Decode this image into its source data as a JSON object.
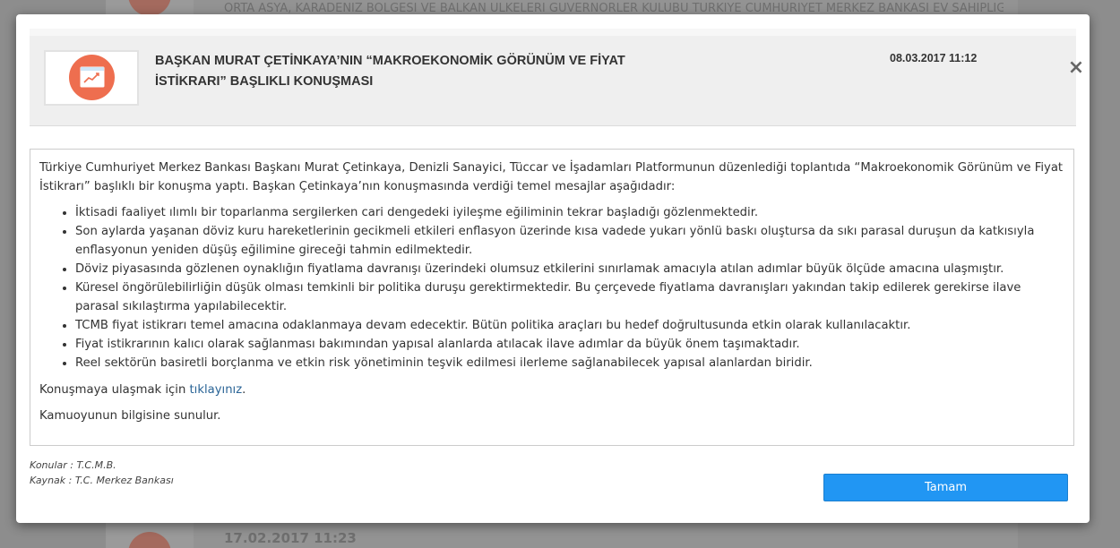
{
  "background": {
    "top_text": "ORTA ASYA, KARADENİZ BÖLGESİ VE BALKAN ÜLKELERİ GUVERNÖRLER KULÜBÜ TÜRKİYE CUMHURİYET MERKEZ BANKASI EV SAHİPLİĞİNDE",
    "bottom_text": "17.02.2017 11:23"
  },
  "modal": {
    "title": "BAŞKAN MURAT ÇETİNKAYA’NIN “MAKROEKONOMİK GÖRÜNÜM VE FİYAT İSTİKRARI” BAŞLIKLI KONUŞMASI",
    "date": "08.03.2017 11:12",
    "close_icon": "close-icon",
    "thumb_icon": "chart-window-icon",
    "intro": "Türkiye Cumhuriyet Merkez Bankası Başkanı Murat Çetinkaya, Denizli Sanayici, Tüccar ve İşadamları Platformunun düzenlediği toplantıda “Makroekonomik Görünüm ve Fiyat İstikrarı” başlıklı bir konuşma yaptı. Başkan Çetinkaya’nın konuşmasında verdiği temel mesajlar aşağıdadır:",
    "bullets": [
      "İktisadi faaliyet ılımlı bir toparlanma sergilerken cari dengedeki iyileşme eğiliminin tekrar başladığı gözlenmektedir.",
      "Son aylarda yaşanan döviz kuru hareketlerinin gecikmeli etkileri enflasyon üzerinde kısa vadede yukarı yönlü baskı oluştursa da sıkı parasal duruşun da katkısıyla enflasyonun yeniden düşüş eğilimine gireceği tahmin edilmektedir.",
      "Döviz piyasasında gözlenen oynaklığın fiyatlama davranışı üzerindeki olumsuz etkilerini sınırlamak amacıyla atılan adımlar büyük ölçüde amacına ulaşmıştır.",
      "Küresel öngörülebilirliğin düşük olması temkinli bir politika duruşu gerektirmektedir. Bu çerçevede fiyatlama davranışları yakından takip edilerek gerekirse ilave parasal sıkılaştırma yapılabilecektir.",
      "TCMB fiyat istikrarı temel amacına odaklanmaya devam edecektir. Bütün politika araçları bu hedef doğrultusunda etkin olarak kullanılacaktır.",
      "Fiyat istikrarının kalıcı olarak sağlanması bakımından yapısal alanlarda atılacak ilave adımlar da büyük önem taşımaktadır.",
      "Reel sektörün basiretli borçlanma ve etkin risk yönetiminin teşvik edilmesi ilerleme sağlanabilecek yapısal alanlardan biridir."
    ],
    "link_prefix": "Konuşmaya ulaşmak için ",
    "link_text": "tıklayınız",
    "link_suffix": ".",
    "closing": "Kamuoyunun bilgisine sunulur.",
    "topics": "Konular : T.C.M.B.",
    "source": "Kaynak : T.C. Merkez Bankası",
    "ok_label": "Tamam"
  },
  "colors": {
    "accent_button": "#2196f3",
    "thumb_circle": "#ee6e4f",
    "link": "#2a6496"
  }
}
